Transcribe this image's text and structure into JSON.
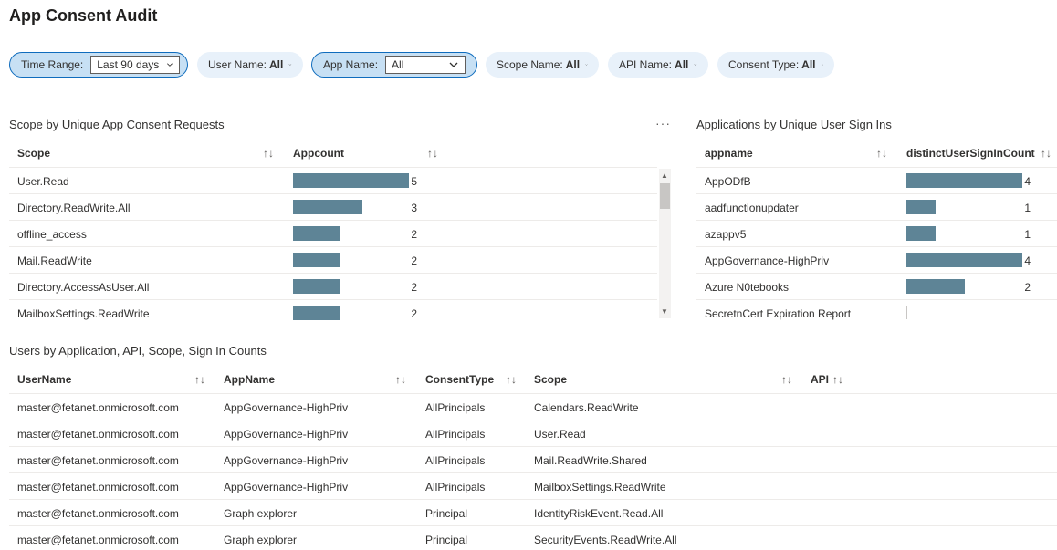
{
  "page": {
    "title": "App Consent Audit"
  },
  "filters": {
    "time_range": {
      "label": "Time Range:",
      "value": "Last 90 days"
    },
    "user_name": {
      "label": "User Name:",
      "value": "All"
    },
    "app_name": {
      "label": "App Name:",
      "value": "All"
    },
    "scope_name": {
      "label": "Scope Name:",
      "value": "All"
    },
    "api_name": {
      "label": "API Name:",
      "value": "All"
    },
    "consent_type": {
      "label": "Consent Type:",
      "value": "All"
    }
  },
  "scope_panel": {
    "title": "Scope by Unique App Consent Requests",
    "more_label": "···",
    "headers": {
      "scope": "Scope",
      "count": "Appcount"
    },
    "rows": [
      {
        "scope": "User.Read",
        "count": 5
      },
      {
        "scope": "Directory.ReadWrite.All",
        "count": 3
      },
      {
        "scope": "offline_access",
        "count": 2
      },
      {
        "scope": "Mail.ReadWrite",
        "count": 2
      },
      {
        "scope": "Directory.AccessAsUser.All",
        "count": 2
      },
      {
        "scope": "MailboxSettings.ReadWrite",
        "count": 2
      }
    ]
  },
  "apps_panel": {
    "title": "Applications by Unique User Sign Ins",
    "headers": {
      "app": "appname",
      "count": "distinctUserSignInCount"
    },
    "rows": [
      {
        "app": "AppODfB",
        "count": 4
      },
      {
        "app": "aadfunctionupdater",
        "count": 1
      },
      {
        "app": "azappv5",
        "count": 1
      },
      {
        "app": "AppGovernance-HighPriv",
        "count": 4
      },
      {
        "app": "Azure N0tebooks",
        "count": 2
      },
      {
        "app": "SecretnCert Expiration Report",
        "count": 0
      }
    ]
  },
  "users_panel": {
    "title": "Users by Application, API, Scope, Sign In Counts",
    "headers": {
      "user": "UserName",
      "app": "AppName",
      "consent": "ConsentType",
      "scope": "Scope",
      "api": "API"
    },
    "rows": [
      {
        "user": "master@fetanet.onmicrosoft.com",
        "app": "AppGovernance-HighPriv",
        "consent": "AllPrincipals",
        "scope": "Calendars.ReadWrite"
      },
      {
        "user": "master@fetanet.onmicrosoft.com",
        "app": "AppGovernance-HighPriv",
        "consent": "AllPrincipals",
        "scope": "User.Read"
      },
      {
        "user": "master@fetanet.onmicrosoft.com",
        "app": "AppGovernance-HighPriv",
        "consent": "AllPrincipals",
        "scope": "Mail.ReadWrite.Shared"
      },
      {
        "user": "master@fetanet.onmicrosoft.com",
        "app": "AppGovernance-HighPriv",
        "consent": "AllPrincipals",
        "scope": "MailboxSettings.ReadWrite"
      },
      {
        "user": "master@fetanet.onmicrosoft.com",
        "app": "Graph explorer",
        "consent": "Principal",
        "scope": "IdentityRiskEvent.Read.All"
      },
      {
        "user": "master@fetanet.onmicrosoft.com",
        "app": "Graph explorer",
        "consent": "Principal",
        "scope": "SecurityEvents.ReadWrite.All"
      }
    ]
  },
  "icons": {
    "sort": "sort-icon",
    "chevron": "chevron-down-icon",
    "more": "more-icon"
  },
  "colors": {
    "bar": "#5e8496",
    "pill": "#e8f1fa",
    "pill_active": "#c7e0f4",
    "accent": "#0f6cbd"
  }
}
